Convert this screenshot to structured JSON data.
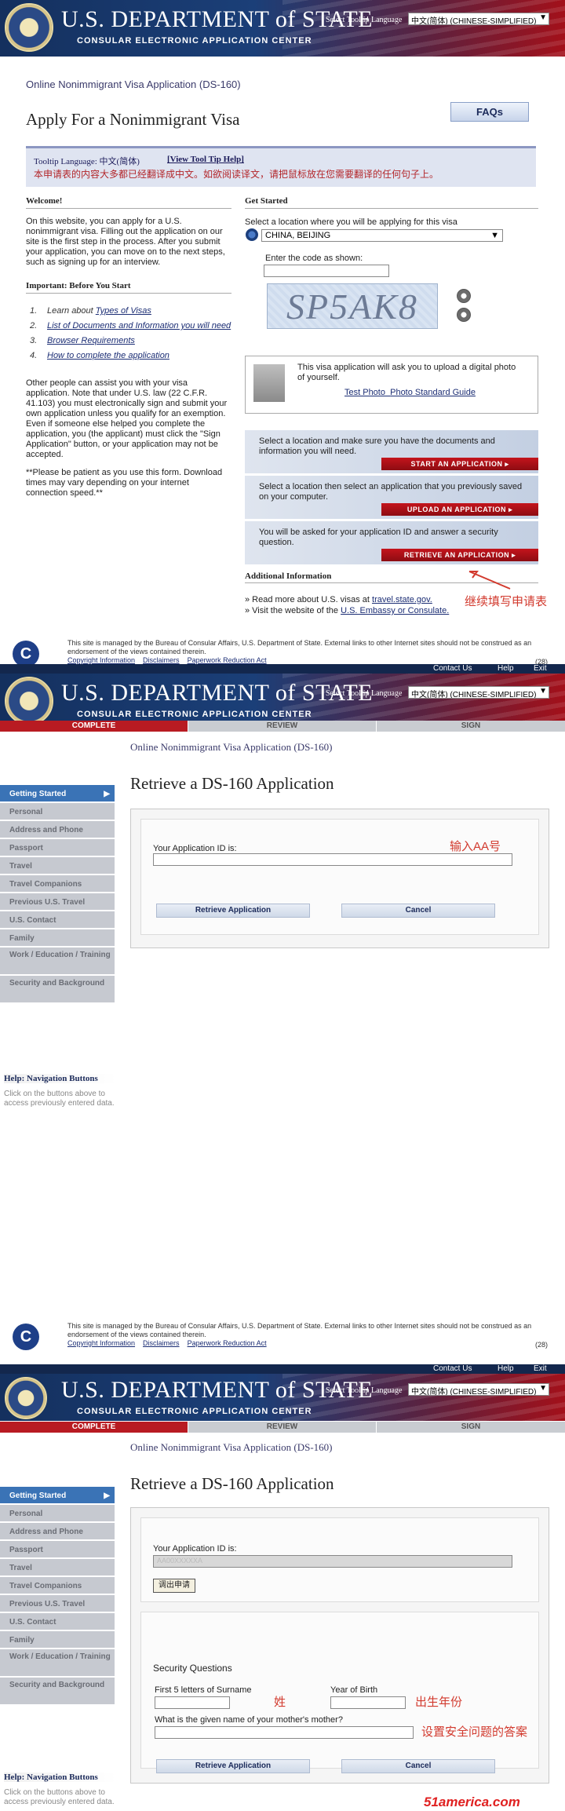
{
  "header": {
    "title_line": "U.S. DEPARTMENT of STATE",
    "subtitle": "CONSULAR ELECTRONIC APPLICATION CENTER",
    "tooltip_label": "Select Tooltip Language",
    "tooltip_value": "中文(简体)  (CHINESE-SIMPLIFIED)",
    "top_links": [
      "Contact Us",
      "Help",
      "Exit"
    ]
  },
  "page1": {
    "breadcrumb": "Online Nonimmigrant Visa Application (DS-160)",
    "title": "Apply For a Nonimmigrant Visa",
    "faqs": "FAQs",
    "tooltip_language": "Tooltip Language: 中文(简体)",
    "view_tooltip_help": "[View Tool Tip Help]",
    "tooltip_note": "本申请表的内容大多都已经翻译成中文。如欲阅读译文，请把鼠标放在您需要翻译的任何句子上。",
    "welcome_heading": "Welcome!",
    "welcome_text": "On this website, you can apply for a U.S. nonimmigrant visa. Filling out the application on our site is the first step in the process. After you submit your application, you can move on to the next steps, such as signing up for an interview.",
    "important_heading": "Important: Before You Start",
    "list": [
      {
        "num": "1.",
        "pre": "Learn about ",
        "link": "Types of Visas"
      },
      {
        "num": "2.",
        "pre": "",
        "link": "List of Documents and Information you will need"
      },
      {
        "num": "3.",
        "pre": "",
        "link": "Browser Requirements"
      },
      {
        "num": "4.",
        "pre": "",
        "link": "How to complete the application"
      }
    ],
    "assist_text": "Other people can assist you with your visa application. Note that under U.S. law (22 C.F.R. 41.103) you must electronically sign and submit your own application unless you qualify for an exemption. Even if someone else helped you complete the application, you (the applicant) must click the \"Sign Application\" button, or your application may not be accepted.",
    "patience_text": "**Please be patient as you use this form. Download times may vary depending on your internet connection speed.**",
    "get_started_heading": "Get Started",
    "location_label": "Select a location where you will be applying for this visa",
    "location_value": "CHINA, BEIJING",
    "code_label": "Enter the code as shown:",
    "captcha_text": "SP5AK8",
    "photo_text": "This visa application will ask you to upload a digital photo of yourself.",
    "test_photo": "Test Photo",
    "photo_guide": "Photo Standard Guide",
    "start_text": "Select a location and make sure you have the documents and information you will need.",
    "start_btn": "START AN APPLICATION",
    "upload_text": "Select a location then select an application that you previously saved on your computer.",
    "upload_btn": "UPLOAD AN APPLICATION",
    "retrieve_text": "You will be asked for your application ID and answer a security question.",
    "retrieve_btn": "RETRIEVE AN APPLICATION",
    "additional_heading": "Additional Information",
    "addl_1_pre": "» Read more about U.S. visas at ",
    "addl_1_link": "travel.state.gov.",
    "addl_2_pre": "» Visit the website of the ",
    "addl_2_link": "U.S. Embassy or Consulate.",
    "annotation": "继续填写申请表"
  },
  "footer": {
    "text": "This site is managed by the Bureau of Consular Affairs, U.S. Department of State. External links to other Internet sites should not be construed as an endorsement of the views contained therein.",
    "links": [
      "Copyright Information",
      "Disclaimers",
      "Paperwork Reduction Act"
    ],
    "num": "(28)"
  },
  "progress": [
    "COMPLETE",
    "REVIEW",
    "SIGN"
  ],
  "retrieve": {
    "breadcrumb": "Online Nonimmigrant Visa Application (DS-160)",
    "title": "Retrieve a DS-160 Application",
    "sidebar": [
      "Getting Started",
      "Personal",
      "Address and Phone",
      "Passport",
      "Travel",
      "Travel Companions",
      "Previous U.S. Travel",
      "U.S. Contact",
      "Family",
      "Work / Education / Training",
      "Security and Background"
    ],
    "help_title": "Help: Navigation Buttons",
    "help_text": "Click on the buttons above to access previously entered data.",
    "app_id_label": "Your Application ID is:",
    "app_id_value": "AA00XXXXXA",
    "retrieve_btn": "Retrieve Application",
    "cancel_btn": "Cancel",
    "annotation_aa": "输入AA号",
    "callout_btn": "调出申请",
    "security_heading": "Security Questions",
    "surname_label": "First 5 letters of Surname",
    "birth_label": "Year of Birth",
    "mother_label": "What is the given name of your mother's mother?",
    "ann_surname": "姓",
    "ann_birth": "出生年份",
    "ann_security": "设置安全问题的答案"
  },
  "watermark": "51america.com"
}
